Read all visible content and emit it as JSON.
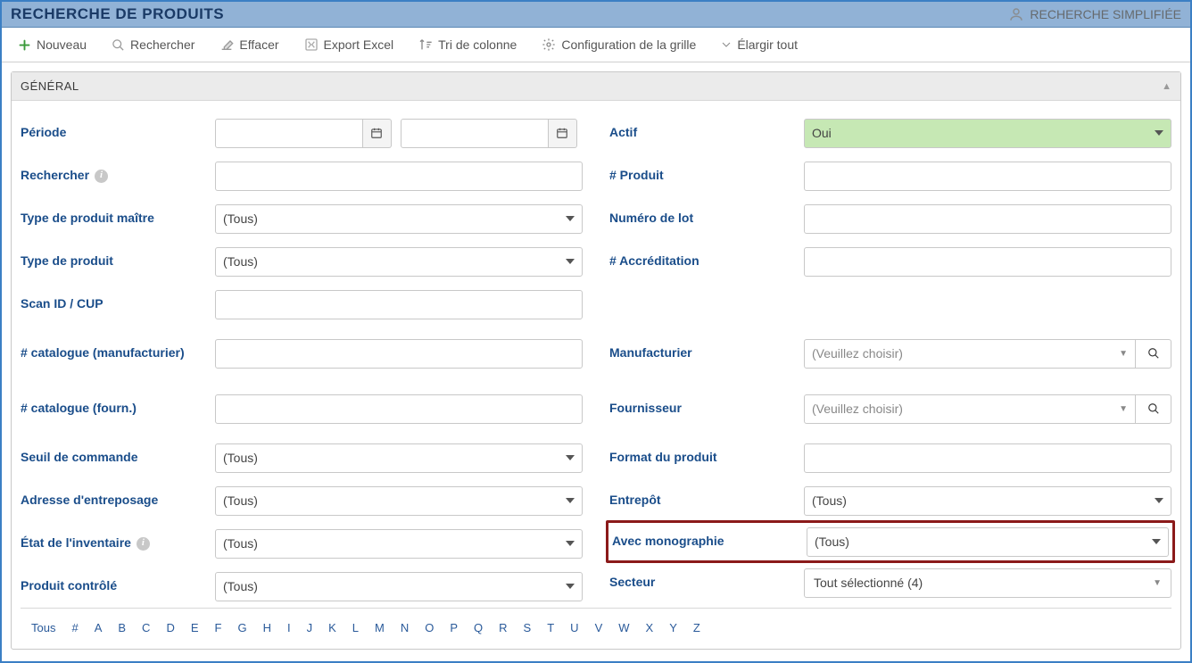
{
  "title": "RECHERCHE DE PRODUITS",
  "simplified_link": "RECHERCHE SIMPLIFIÉE",
  "toolbar": {
    "new": "Nouveau",
    "search": "Rechercher",
    "clear": "Effacer",
    "export": "Export Excel",
    "sort": "Tri de colonne",
    "config": "Configuration de la grille",
    "expand": "Élargir tout"
  },
  "panel": {
    "title": "GÉNÉRAL"
  },
  "labels": {
    "periode": "Période",
    "rechercher": "Rechercher",
    "type_produit_maitre": "Type de produit maître",
    "type_produit": "Type de produit",
    "scan_id": "Scan ID / CUP",
    "catalogue_manuf": "# catalogue (manufacturier)",
    "catalogue_fourn": "# catalogue (fourn.)",
    "seuil": "Seuil de commande",
    "adresse": "Adresse d'entreposage",
    "etat": "État de l'inventaire",
    "controle": "Produit contrôlé",
    "actif": "Actif",
    "num_produit": "# Produit",
    "num_lot": "Numéro de lot",
    "accreditation": "# Accréditation",
    "manufacturier": "Manufacturier",
    "fournisseur": "Fournisseur",
    "format": "Format du produit",
    "entrepot": "Entrepôt",
    "monographie": "Avec monographie",
    "secteur": "Secteur"
  },
  "values": {
    "tous": "(Tous)",
    "oui": "Oui",
    "choisir": "(Veuillez choisir)",
    "secteur_val": "Tout sélectionné (4)"
  },
  "alpha": [
    "Tous",
    "#",
    "A",
    "B",
    "C",
    "D",
    "E",
    "F",
    "G",
    "H",
    "I",
    "J",
    "K",
    "L",
    "M",
    "N",
    "O",
    "P",
    "Q",
    "R",
    "S",
    "T",
    "U",
    "V",
    "W",
    "X",
    "Y",
    "Z"
  ]
}
